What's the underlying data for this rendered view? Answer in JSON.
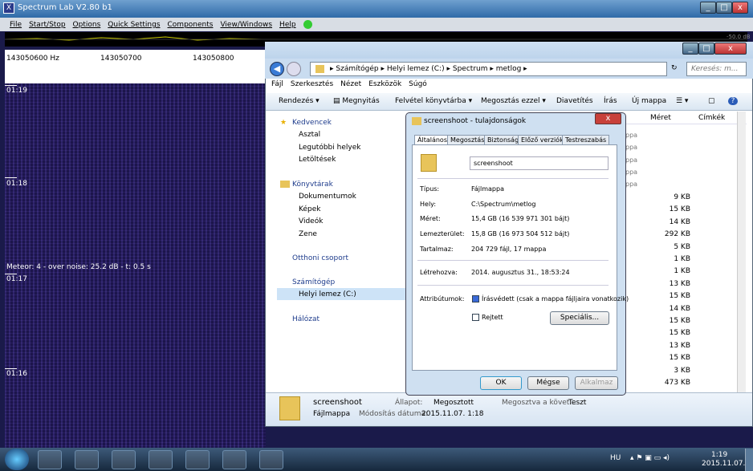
{
  "spectrum": {
    "title": "Spectrum Lab V2.80 b1",
    "menu": [
      "File",
      "Start/Stop",
      "Options",
      "Quick Settings",
      "Components",
      "View/Windows",
      "Help"
    ],
    "freqs": [
      "143050600 Hz",
      "143050700",
      "143050800"
    ],
    "db": "-50.0 dB",
    "times": [
      "01:19",
      "01:18",
      "01:17",
      "01:16"
    ],
    "meteor": "Meteor:  4  - over noise: 25.2 dB -   t:  0.5 s"
  },
  "explorer": {
    "crumbs": [
      "Számítógép",
      "Helyi lemez (C:)",
      "Spectrum",
      "metlog"
    ],
    "search": "Keresés: m...",
    "menu": [
      "Fájl",
      "Szerkesztés",
      "Nézet",
      "Eszközök",
      "Súgó"
    ],
    "toolbar": [
      "Rendezés",
      "Megnyitás",
      "Felvétel könyvtárba",
      "Megosztás ezzel",
      "Diavetítés",
      "Írás",
      "Új mappa"
    ],
    "nav": {
      "fav": "Kedvencek",
      "fav_items": [
        "Asztal",
        "Legutóbbi helyek",
        "Letöltések"
      ],
      "lib": "Könyvtárak",
      "lib_items": [
        "Dokumentumok",
        "Képek",
        "Videók",
        "Zene"
      ],
      "home": "Otthoni csoport",
      "pc": "Számítógép",
      "pc_items": [
        "Helyi lemez (C:)"
      ],
      "net": "Hálózat"
    },
    "columns": [
      "Méret",
      "Címkék"
    ],
    "partial": [
      "ppa",
      "ppa",
      "ppa",
      "ppa",
      "ppa"
    ],
    "sizes": [
      "9 KB",
      "15 KB",
      "14 KB",
      "292 KB",
      "5 KB",
      "1 KB",
      "1 KB",
      "13 KB",
      "15 KB",
      "14 KB",
      "15 KB",
      "15 KB",
      "13 KB",
      "15 KB",
      "3 KB",
      "473 KB"
    ],
    "details": {
      "name": "screenshoot",
      "type": "Fájlmappa",
      "state_lbl": "Állapot:",
      "state": "Megosztott",
      "mod_lbl": "Módosítás dátuma:",
      "mod": "2015.11.07. 1:18",
      "shared": "Megosztva a követ...",
      "shared_val": "Teszt"
    }
  },
  "dialog": {
    "title": "screenshoot - tulajdonságok",
    "tabs": [
      "Általános",
      "Megosztás",
      "Biztonság",
      "Előző verziók",
      "Testreszabás"
    ],
    "name": "screenshoot",
    "rows": [
      {
        "l": "Típus:",
        "v": "Fájlmappa"
      },
      {
        "l": "Hely:",
        "v": "C:\\Spectrum\\metlog"
      },
      {
        "l": "Méret:",
        "v": "15,4 GB (16 539 971 301 bájt)"
      },
      {
        "l": "Lemezterület:",
        "v": "15,8 GB (16 973 504 512 bájt)"
      },
      {
        "l": "Tartalmaz:",
        "v": "204 729 fájl, 17 mappa"
      }
    ],
    "created_lbl": "Létrehozva:",
    "created": "2014. augusztus 31., 18:53:24",
    "attr_lbl": "Attribútumok:",
    "readonly": "Írásvédett (csak a mappa fájljaira vonatkozik)",
    "hidden": "Rejtett",
    "special": "Speciális...",
    "ok": "OK",
    "cancel": "Mégse",
    "apply": "Alkalmaz"
  },
  "tray": {
    "lang": "HU",
    "time": "1:19",
    "date": "2015.11.07."
  }
}
